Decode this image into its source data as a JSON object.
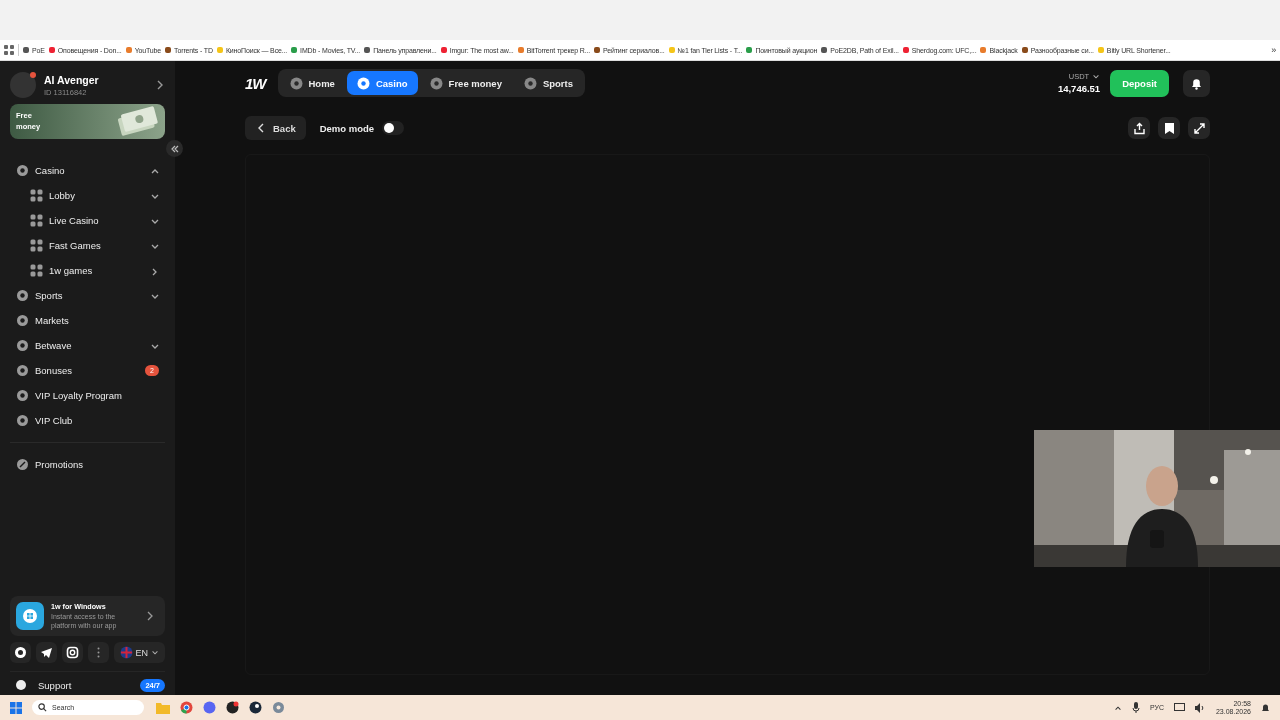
{
  "bookmarks": [
    {
      "label": "PoE"
    },
    {
      "label": "Оповещения - Don..."
    },
    {
      "label": "YouTube"
    },
    {
      "label": "Torrents - TD"
    },
    {
      "label": "КиноПоиск — Все..."
    },
    {
      "label": "IMDb - Movies, TV..."
    },
    {
      "label": "Панель управлени..."
    },
    {
      "label": "Imgur: The most aw..."
    },
    {
      "label": "BitTorrent трекер R..."
    },
    {
      "label": "Рейтинг сериалов..."
    },
    {
      "label": "№1 fan Tier Lists - T..."
    },
    {
      "label": "Поинтовый аукцион"
    },
    {
      "label": "PoE2DB, Path of Exil..."
    },
    {
      "label": "Sherdog.com: UFC,..."
    },
    {
      "label": "Blackjack"
    },
    {
      "label": "Разнообразные си..."
    },
    {
      "label": "Bitly URL Shortener..."
    }
  ],
  "bookmarks_more": "»",
  "user": {
    "name": "AI Avenger",
    "id": "ID 13116842",
    "promo": "Free money"
  },
  "nav": [
    {
      "label": "Casino",
      "kind": "group",
      "expanded": true,
      "children": [
        {
          "label": "Lobby",
          "kind": "group",
          "expanded": false
        },
        {
          "label": "Live Casino",
          "kind": "group",
          "expanded": false
        },
        {
          "label": "Fast Games",
          "kind": "group",
          "expanded": false
        },
        {
          "label": "1w games",
          "kind": "link"
        }
      ]
    },
    {
      "label": "Sports",
      "kind": "group",
      "expanded": false
    },
    {
      "label": "Markets",
      "kind": "plain"
    },
    {
      "label": "Betwave",
      "kind": "group",
      "expanded": false
    },
    {
      "label": "Bonuses",
      "kind": "plain",
      "badge": "2"
    },
    {
      "label": "VIP Loyalty Program",
      "kind": "plain"
    },
    {
      "label": "VIP Club",
      "kind": "plain"
    }
  ],
  "promotions": "Promotions",
  "app_card": {
    "title": "1w for Windows",
    "text": "Instant access to the platform with our app"
  },
  "language": "EN",
  "support": {
    "label": "Support",
    "badge": "24/7"
  },
  "logo": "1W",
  "tabs": [
    {
      "label": "Home",
      "selected": false
    },
    {
      "label": "Casino",
      "selected": true
    },
    {
      "label": "Free money",
      "selected": false
    },
    {
      "label": "Sports",
      "selected": false
    }
  ],
  "balance": {
    "currency": "USDT",
    "amount": "14,746.51"
  },
  "deposit": "Deposit",
  "back": "Back",
  "demo_mode": {
    "label": "Demo mode",
    "on": false
  },
  "taskbar": {
    "search": "Search",
    "language": "РУС",
    "time": "20:58",
    "date": "23.08.2026"
  }
}
